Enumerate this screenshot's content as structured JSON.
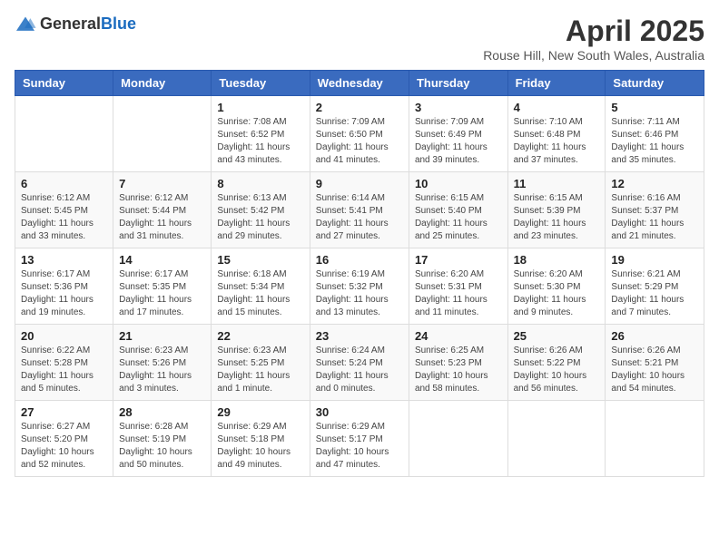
{
  "header": {
    "logo_general": "General",
    "logo_blue": "Blue",
    "month_year": "April 2025",
    "location": "Rouse Hill, New South Wales, Australia"
  },
  "days_of_week": [
    "Sunday",
    "Monday",
    "Tuesday",
    "Wednesday",
    "Thursday",
    "Friday",
    "Saturday"
  ],
  "weeks": [
    [
      {
        "day": "",
        "info": ""
      },
      {
        "day": "",
        "info": ""
      },
      {
        "day": "1",
        "info": "Sunrise: 7:08 AM\nSunset: 6:52 PM\nDaylight: 11 hours and 43 minutes."
      },
      {
        "day": "2",
        "info": "Sunrise: 7:09 AM\nSunset: 6:50 PM\nDaylight: 11 hours and 41 minutes."
      },
      {
        "day": "3",
        "info": "Sunrise: 7:09 AM\nSunset: 6:49 PM\nDaylight: 11 hours and 39 minutes."
      },
      {
        "day": "4",
        "info": "Sunrise: 7:10 AM\nSunset: 6:48 PM\nDaylight: 11 hours and 37 minutes."
      },
      {
        "day": "5",
        "info": "Sunrise: 7:11 AM\nSunset: 6:46 PM\nDaylight: 11 hours and 35 minutes."
      }
    ],
    [
      {
        "day": "6",
        "info": "Sunrise: 6:12 AM\nSunset: 5:45 PM\nDaylight: 11 hours and 33 minutes."
      },
      {
        "day": "7",
        "info": "Sunrise: 6:12 AM\nSunset: 5:44 PM\nDaylight: 11 hours and 31 minutes."
      },
      {
        "day": "8",
        "info": "Sunrise: 6:13 AM\nSunset: 5:42 PM\nDaylight: 11 hours and 29 minutes."
      },
      {
        "day": "9",
        "info": "Sunrise: 6:14 AM\nSunset: 5:41 PM\nDaylight: 11 hours and 27 minutes."
      },
      {
        "day": "10",
        "info": "Sunrise: 6:15 AM\nSunset: 5:40 PM\nDaylight: 11 hours and 25 minutes."
      },
      {
        "day": "11",
        "info": "Sunrise: 6:15 AM\nSunset: 5:39 PM\nDaylight: 11 hours and 23 minutes."
      },
      {
        "day": "12",
        "info": "Sunrise: 6:16 AM\nSunset: 5:37 PM\nDaylight: 11 hours and 21 minutes."
      }
    ],
    [
      {
        "day": "13",
        "info": "Sunrise: 6:17 AM\nSunset: 5:36 PM\nDaylight: 11 hours and 19 minutes."
      },
      {
        "day": "14",
        "info": "Sunrise: 6:17 AM\nSunset: 5:35 PM\nDaylight: 11 hours and 17 minutes."
      },
      {
        "day": "15",
        "info": "Sunrise: 6:18 AM\nSunset: 5:34 PM\nDaylight: 11 hours and 15 minutes."
      },
      {
        "day": "16",
        "info": "Sunrise: 6:19 AM\nSunset: 5:32 PM\nDaylight: 11 hours and 13 minutes."
      },
      {
        "day": "17",
        "info": "Sunrise: 6:20 AM\nSunset: 5:31 PM\nDaylight: 11 hours and 11 minutes."
      },
      {
        "day": "18",
        "info": "Sunrise: 6:20 AM\nSunset: 5:30 PM\nDaylight: 11 hours and 9 minutes."
      },
      {
        "day": "19",
        "info": "Sunrise: 6:21 AM\nSunset: 5:29 PM\nDaylight: 11 hours and 7 minutes."
      }
    ],
    [
      {
        "day": "20",
        "info": "Sunrise: 6:22 AM\nSunset: 5:28 PM\nDaylight: 11 hours and 5 minutes."
      },
      {
        "day": "21",
        "info": "Sunrise: 6:23 AM\nSunset: 5:26 PM\nDaylight: 11 hours and 3 minutes."
      },
      {
        "day": "22",
        "info": "Sunrise: 6:23 AM\nSunset: 5:25 PM\nDaylight: 11 hours and 1 minute."
      },
      {
        "day": "23",
        "info": "Sunrise: 6:24 AM\nSunset: 5:24 PM\nDaylight: 11 hours and 0 minutes."
      },
      {
        "day": "24",
        "info": "Sunrise: 6:25 AM\nSunset: 5:23 PM\nDaylight: 10 hours and 58 minutes."
      },
      {
        "day": "25",
        "info": "Sunrise: 6:26 AM\nSunset: 5:22 PM\nDaylight: 10 hours and 56 minutes."
      },
      {
        "day": "26",
        "info": "Sunrise: 6:26 AM\nSunset: 5:21 PM\nDaylight: 10 hours and 54 minutes."
      }
    ],
    [
      {
        "day": "27",
        "info": "Sunrise: 6:27 AM\nSunset: 5:20 PM\nDaylight: 10 hours and 52 minutes."
      },
      {
        "day": "28",
        "info": "Sunrise: 6:28 AM\nSunset: 5:19 PM\nDaylight: 10 hours and 50 minutes."
      },
      {
        "day": "29",
        "info": "Sunrise: 6:29 AM\nSunset: 5:18 PM\nDaylight: 10 hours and 49 minutes."
      },
      {
        "day": "30",
        "info": "Sunrise: 6:29 AM\nSunset: 5:17 PM\nDaylight: 10 hours and 47 minutes."
      },
      {
        "day": "",
        "info": ""
      },
      {
        "day": "",
        "info": ""
      },
      {
        "day": "",
        "info": ""
      }
    ]
  ]
}
